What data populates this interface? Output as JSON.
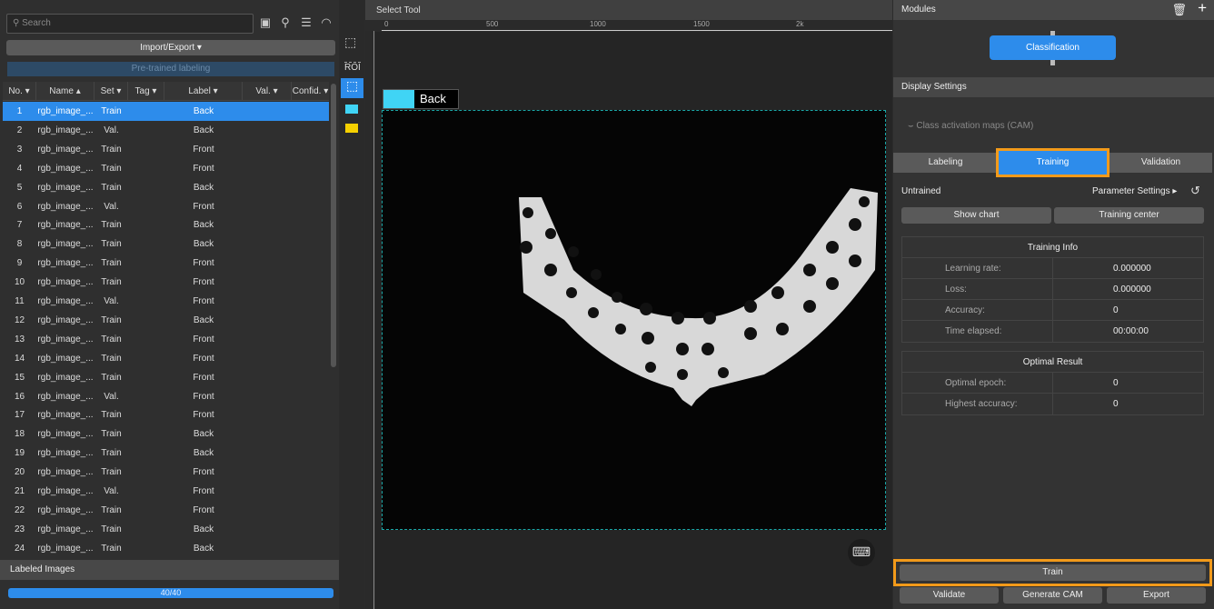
{
  "left": {
    "search_placeholder": "Search",
    "import_export": "Import/Export ▾",
    "pretrained": "Pre-trained labeling",
    "columns": [
      "No. ▾",
      "Name ▴",
      "Set ▾",
      "Tag ▾",
      "Label ▾",
      "Val. ▾",
      "Confid. ▾"
    ],
    "rows": [
      [
        "1",
        "rgb_image_...",
        "Train",
        "",
        "Back"
      ],
      [
        "2",
        "rgb_image_...",
        "Val.",
        "",
        "Back"
      ],
      [
        "3",
        "rgb_image_...",
        "Train",
        "",
        "Front"
      ],
      [
        "4",
        "rgb_image_...",
        "Train",
        "",
        "Front"
      ],
      [
        "5",
        "rgb_image_...",
        "Train",
        "",
        "Back"
      ],
      [
        "6",
        "rgb_image_...",
        "Val.",
        "",
        "Front"
      ],
      [
        "7",
        "rgb_image_...",
        "Train",
        "",
        "Back"
      ],
      [
        "8",
        "rgb_image_...",
        "Train",
        "",
        "Back"
      ],
      [
        "9",
        "rgb_image_...",
        "Train",
        "",
        "Front"
      ],
      [
        "10",
        "rgb_image_...",
        "Train",
        "",
        "Front"
      ],
      [
        "11",
        "rgb_image_...",
        "Val.",
        "",
        "Front"
      ],
      [
        "12",
        "rgb_image_...",
        "Train",
        "",
        "Back"
      ],
      [
        "13",
        "rgb_image_...",
        "Train",
        "",
        "Front"
      ],
      [
        "14",
        "rgb_image_...",
        "Train",
        "",
        "Front"
      ],
      [
        "15",
        "rgb_image_...",
        "Train",
        "",
        "Front"
      ],
      [
        "16",
        "rgb_image_...",
        "Val.",
        "",
        "Front"
      ],
      [
        "17",
        "rgb_image_...",
        "Train",
        "",
        "Front"
      ],
      [
        "18",
        "rgb_image_...",
        "Train",
        "",
        "Back"
      ],
      [
        "19",
        "rgb_image_...",
        "Train",
        "",
        "Back"
      ],
      [
        "20",
        "rgb_image_...",
        "Train",
        "",
        "Front"
      ],
      [
        "21",
        "rgb_image_...",
        "Val.",
        "",
        "Front"
      ],
      [
        "22",
        "rgb_image_...",
        "Train",
        "",
        "Front"
      ],
      [
        "23",
        "rgb_image_...",
        "Train",
        "",
        "Back"
      ],
      [
        "24",
        "rgb_image_...",
        "Train",
        "",
        "Back"
      ]
    ],
    "labeled_title": "Labeled Images",
    "progress_text": "40/40",
    "progress_value": 1.0
  },
  "tools": {
    "roi": "ROI",
    "class_colors": [
      "#40d4f5",
      "#f5d000"
    ]
  },
  "canvas": {
    "title": "Select Tool",
    "ruler_ticks": [
      "0",
      "500",
      "1000",
      "1500",
      "2k"
    ],
    "label_tag": "Back",
    "label_color": "#40d4f5"
  },
  "right": {
    "modules_title": "Modules",
    "module": "Classification",
    "display_settings": "Display Settings",
    "cam": "Class activation maps (CAM)",
    "tabs": [
      "Labeling",
      "Training",
      "Validation"
    ],
    "active_tab": "Training",
    "status": "Untrained",
    "param_settings": "Parameter Settings ▸",
    "show_chart": "Show chart",
    "training_center": "Training center",
    "training_info": {
      "title": "Training Info",
      "rows": [
        [
          "Learning rate:",
          "0.000000"
        ],
        [
          "Loss:",
          "0.000000"
        ],
        [
          "Accuracy:",
          "0"
        ],
        [
          "Time elapsed:",
          "00:00:00"
        ]
      ]
    },
    "optimal": {
      "title": "Optimal Result",
      "rows": [
        [
          "Optimal epoch:",
          "0"
        ],
        [
          "Highest accuracy:",
          "0"
        ]
      ]
    },
    "train": "Train",
    "validate": "Validate",
    "generate_cam": "Generate CAM",
    "export": "Export"
  },
  "colors": {
    "accent": "#2d8ceb",
    "highlight": "#f29a1a"
  }
}
